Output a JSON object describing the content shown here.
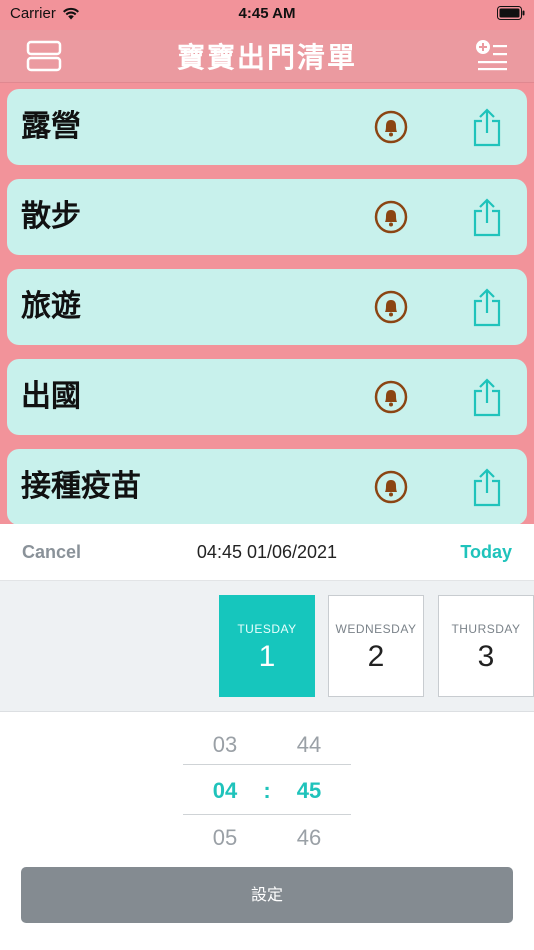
{
  "status": {
    "carrier": "Carrier",
    "time": "4:45 AM"
  },
  "nav": {
    "title": "寶寶出門清單"
  },
  "lists": [
    {
      "label": "露營"
    },
    {
      "label": "散步"
    },
    {
      "label": "旅遊"
    },
    {
      "label": "出國"
    },
    {
      "label": "接種疫苗"
    }
  ],
  "picker": {
    "cancel_label": "Cancel",
    "header_date": "04:45 01/06/2021",
    "today_label": "Today",
    "days": [
      {
        "name": "TUESDAY",
        "num": "1",
        "selected": true
      },
      {
        "name": "WEDNESDAY",
        "num": "2",
        "selected": false
      },
      {
        "name": "THURSDAY",
        "num": "3",
        "selected": false
      }
    ],
    "hours": [
      "03",
      "04",
      "05"
    ],
    "minutes": [
      "44",
      "45",
      "46"
    ],
    "separator": ":",
    "set_label": "設定"
  },
  "colors": {
    "pink": "#f2939a",
    "mint": "#c8f1ec",
    "teal": "#1fc3bb",
    "bell": "#8b4513"
  }
}
